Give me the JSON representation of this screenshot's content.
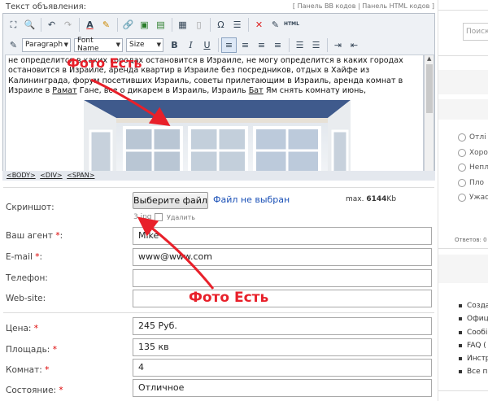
{
  "form": {
    "text_label": "Текст объявления:",
    "panel_links": {
      "open": "[",
      "bb": "Панель BB кодов",
      "sep": "|",
      "html": "Панель HTML кодов",
      "close": "]"
    },
    "editor": {
      "toolbar_row1_icons": [
        "preview-icon",
        "find-icon",
        "undo-icon",
        "redo-icon",
        "font-color-icon",
        "highlight-icon",
        "link-icon",
        "image-icon",
        "flash-icon",
        "table-icon",
        "page-break-icon",
        "special-char-icon",
        "list-icon",
        "remove-format-icon",
        "clean-icon",
        "html-source-icon"
      ],
      "format_select": "Paragraph",
      "font_select": "Font Name",
      "size_select": "Size",
      "bold": "B",
      "italic": "I",
      "underline": "U",
      "content_segments": [
        "не определится в каких городах остановится в Израиле, не могу определится в каких городах остановится в Израиле, аренда квартир в Израиле без посредников, отдых в Хайфе из Калининграда, форум посетивших Израиль, советы прилетающим в Израиль, аренда комнат в Израиле в ",
        "Рамат",
        " Гане, все о дикарем в Израиль, Израиль ",
        "Бат",
        " Ям снять комнату июнь,"
      ],
      "tag_path": [
        "<BODY>",
        "<DIV>",
        "<SPAN>"
      ]
    },
    "screenshot_label": "Скриншот:",
    "file_button": "Выберите файл",
    "file_status": "Файл не выбран",
    "max_prefix": "max.",
    "max_size": "6144",
    "max_unit": "Kb",
    "uploaded_file": "3.jpg",
    "delete_label": "Удалить",
    "fields": [
      {
        "key": "agent",
        "label": "Ваш агент",
        "required": "*",
        "value": "Mike"
      },
      {
        "key": "email",
        "label": "E-mail",
        "required": "*",
        "value": "www@www.com"
      },
      {
        "key": "phone",
        "label": "Телефон:",
        "required": "",
        "value": ""
      },
      {
        "key": "website",
        "label": "Web-site:",
        "required": "",
        "value": ""
      }
    ],
    "fields2": [
      {
        "key": "price",
        "label": "Цена:",
        "required": "*",
        "value": "245 Руб."
      },
      {
        "key": "area",
        "label": "Площадь:",
        "required": "*",
        "value": "135 кв"
      },
      {
        "key": "rooms",
        "label": "Комнат:",
        "required": "*",
        "value": "4"
      },
      {
        "key": "condition",
        "label": "Состояние:",
        "required": "*",
        "value": "Отличное"
      }
    ],
    "colon": ":"
  },
  "annotations": {
    "top": "Фото Есть",
    "bottom": "Фото Есть",
    "color": "#e8202a"
  },
  "sidebar": {
    "search_placeholder": "Поиск",
    "poll_options": [
      "Отлі",
      "Хоро",
      "Неплі",
      "Пло",
      "Ужас"
    ],
    "answers_label": "Ответов:",
    "nav_items": [
      "Созда",
      "Офиц",
      "Сообі",
      "FAQ (",
      "Инстр",
      "Все п"
    ]
  }
}
